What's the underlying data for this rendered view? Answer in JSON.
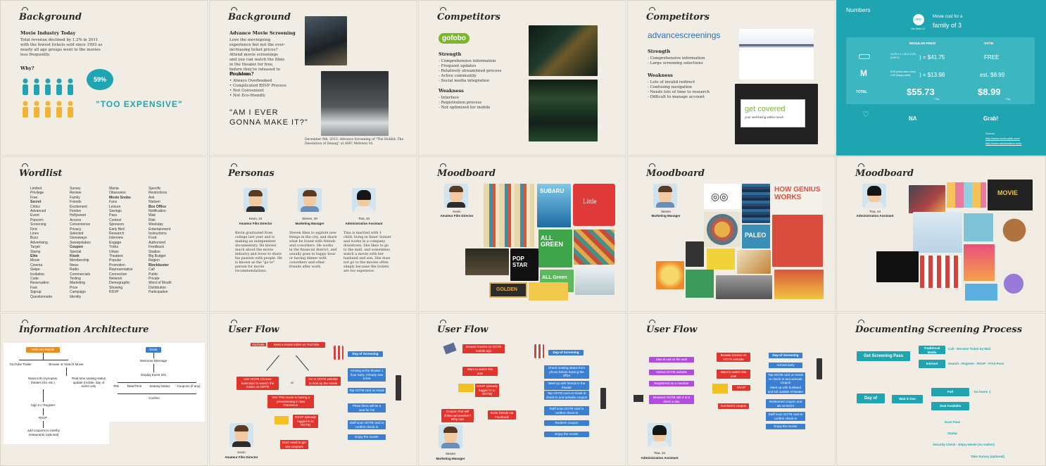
{
  "colors": {
    "paper": "#f1ede4",
    "teal": "#1fa5b1",
    "blue": "#3b7fd0",
    "orange": "#f08a1c",
    "red": "#e0342d",
    "yellow": "#f2c020",
    "green": "#1a6b52",
    "purple": "#b24ce0"
  },
  "slides": {
    "bg1": {
      "title": "Background",
      "heading": "Movie Industry Today",
      "body": "Total revenue declined by 1.2% in 2011 with the fewest tickets sold since 1993 as nearly all age groups went to the movies less frequently.",
      "why": "Why?",
      "percent": "59%",
      "quote": "\"TOO EXPENSIVE\""
    },
    "bg2": {
      "title": "Background",
      "heading": "Advance Movie Screening",
      "body": "Love the moviegoing experience but not the ever-increasing ticket prices? Attend movie screenings and you can watch the films in the theater for free, before they're released to the public.",
      "problem": "Problem?",
      "problems": [
        "• Always Overbooked",
        "• Complicated RSVP Process",
        "• Not Convenient",
        "• Not Eco-friendly"
      ],
      "quote1": "\"Am I ever",
      "quote2": "gonna make it?\"",
      "caption": "December 9th, 2013. Advance Screening of \"The Hobbit: The Desolation of Smaug\" at AMC Metreon 16."
    },
    "comp1": {
      "title": "Competitors",
      "logo": "gofobo",
      "strength": "Strength",
      "strengths": [
        "- Comprehensive information",
        "- Frequent updates",
        "- Relatively streamlined process",
        "- Active community",
        "- Social media integration"
      ],
      "weakness": "Weakness",
      "weaknesses": [
        "- Interface",
        "- Registration process",
        "- Not optimized for mobile"
      ]
    },
    "comp2": {
      "title": "Competitors",
      "logo": "advancescreenings",
      "strength": "Strength",
      "strengths": [
        "- Comprehensive information",
        "- Large screening selections"
      ],
      "weakness": "Weakness",
      "weaknesses": [
        "- Lots of invalid redirect",
        "- Confusing navigation",
        "- Needs lots of time to research",
        "- Difficult to manage account"
      ],
      "ad": "get covered",
      "ad_sub": "your well-being within reach"
    },
    "numbers": {
      "title": "Numbers",
      "amc": "amc",
      "amc_sub": "Van Ness 14",
      "cost_label": "Movie cost for a",
      "family": "family of 3",
      "col1": "REGULAR PRICE",
      "col2": "OOTB",
      "row1_calc": "14.25 X 2 = 28.5  13.25 (CHILD)",
      "row1_val": ") = $41.75",
      "row1_free": "FREE",
      "row2_calc": "8.99 (extra value meal)  4.99 (happy meal)",
      "row2_val": ") = $13.98",
      "row2_ootb": "est. $8.99",
      "total": "TOTAL",
      "total_val": "$55.73",
      "total_ootb": "$8.99",
      "tax": "+Tax",
      "na": "NA",
      "grab": "Grab!",
      "source": "Source:",
      "link1": "http://www.mcdonalds.com/",
      "link2": "http://www.amctheatres.com/"
    },
    "wordlist": {
      "title": "Wordlist",
      "cols": [
        [
          "Limited",
          "Privilege",
          "Free",
          "Secret",
          "Critics",
          "Advanced",
          "Event",
          "Popcorn",
          "Screening",
          "First",
          "Lines",
          "Buzz",
          "Advertising",
          "Target",
          "Stamp",
          "Elite",
          "Movie",
          "Cinema",
          "Swipe",
          "Invitation",
          "Code",
          "Reservation",
          "Fast",
          "Signup",
          "Questionnaire"
        ],
        [
          "Survey",
          "Review",
          "Family",
          "Friends",
          "Excitement",
          "Festive",
          "Hollywood",
          "Access",
          "Convenience",
          "Privacy",
          "Selected",
          "Giveaways",
          "Sweepstakes",
          "Coupon",
          "Special",
          "Kiosk",
          "Membership",
          "News",
          "Radio",
          "Commercials",
          "Texting",
          "Marketing",
          "Prize",
          "Campaign",
          "Identity"
        ],
        [
          "Mania",
          "Obsession",
          "Movie Snobs",
          "Fans",
          "Leisure",
          "Savings",
          "Pass",
          "Contest",
          "Sponsors",
          "Early Bird",
          "Research",
          "Interview",
          "Engage",
          "Tricks",
          "Urban",
          "Theaters",
          "Popular",
          "Promotion",
          "Representative",
          "Connection",
          "Network",
          "Demographic",
          "Showing",
          "RSVP"
        ],
        [
          "Specific",
          "Restrictions",
          "Ask",
          "Nielsen",
          "Box Office",
          "Notification",
          "Wait",
          "Risk",
          "Weekday",
          "Entertainment",
          "Instructions",
          "Food",
          "Authorized",
          "Feedback",
          "Studios",
          "Big Budget",
          "Region",
          "Blockbuster",
          "Call",
          "Public",
          "Private",
          "Word of Mouth",
          "Distribution",
          "Participation"
        ]
      ]
    },
    "personas": {
      "title": "Personas",
      "p1_name": "Kevin, 24",
      "p1_role": "Amateur Film Director",
      "p2_name": "Steven, 29",
      "p2_role": "Marketing Manager",
      "p3_name": "Tina, 34",
      "p3_role": "Administration Assistant",
      "p1_text": "Kevin graduated from college last year and is making an independent documentary. He knows much about the movie industry and loves to share his passion with people. He is known as the \"go to\" person for movie recommendations.",
      "p2_text": "Steven likes to explore new things in the city, and share what he found with friends and coworkers. He works in the financial district, and usually goes to happy hour or having dinner with coworkers and other friends after work.",
      "p3_text": "Tina is married with 1 child, living in Inner Sunset and works in a company downtown. She likes to go to the mall, and sometimes watch a movie with her husband and son. She does not go to the movies often simply because the tickets are too expensive."
    },
    "mood1": {
      "title": "Moodboard",
      "name": "Kevin",
      "role": "Amateur Film Director",
      "t1": "SUBARU",
      "t2": "Little",
      "t3": "ALL GREEN",
      "t4": "ALL Green",
      "t5": "POP STAR",
      "t6": "GOLDEN"
    },
    "mood2": {
      "title": "Moodboard",
      "name": "Steven",
      "role": "Marketing Manager",
      "t1": "HOW GENIUS WORKS",
      "t2": "PALEO"
    },
    "mood3": {
      "title": "Moodboard",
      "name": "Tina, 34",
      "role": "Administration Assistant",
      "t1": "MOVIE"
    },
    "ia": {
      "title": "Information Architecture",
      "web": "Web and Mobile",
      "kiosk": "Kiosk",
      "n1": "YouTube Trailer",
      "n2": "Browse or Search Movie",
      "n3": "Movie  Info (synopsis, theater info, etc.)",
      "n4": "Real-time seating status update (mobile, day of event only",
      "n5": "Sign In / Register",
      "n6": "RSVP",
      "n7": "add coupons to nearby restaurants (optional)",
      "k1": "Welcome Message",
      "k2": "Display Event Info",
      "k3": "Title",
      "k4": "Date/Time",
      "k5": "Seating Status",
      "k6": "Coupons (if any)",
      "k7": "Confirm"
    },
    "flow1": {
      "title": "User Flow",
      "top": "Sees a movie trailer on YouTube",
      "yt": "YouTube",
      "a": "Use OOTB Chrome extension to search the movie on OOTB",
      "or": "or",
      "b": "Go to OOTB website to look up the movie",
      "c": "Yes! This movie is having a prescreening in San Francisco!",
      "d": "RSVP (already logged in to OOTB)",
      "e": "Don't need to get any coupons",
      "day": "Day-of Screening",
      "d1": "Arriving at the theater 1 hour early. Already saw a line",
      "d2": "Tap OOTB card on Kiosk",
      "d3": "Phew there will be a seat for me",
      "d4": "Staff scan OOTB card to confirm check-in",
      "d5": "Enjoy the movie!",
      "name": "Kevin",
      "role": "Amateur Film Director"
    },
    "flow2": {
      "title": "User Flow",
      "top": "Browse movies on OOTB mobile app",
      "a": "Want to watch this one!",
      "b": "RSVP (already logged in to OOTB)",
      "c": "Coupon that will drinks w/coworker? Why not!",
      "d": "Invite friends via Facebook",
      "day": "Day-of Screening",
      "d1": "Check seating status from phone before leaving the office",
      "d2": "Meet up with friends in the theater",
      "d3": "Tap OOTB card on Kiosk to check-in and activate coupon",
      "d4": "Staff scan OOTB card to confirm check-in",
      "d5": "Redeem coupon",
      "d6": "Enjoy the movie!",
      "name": "Steven",
      "role": "Marketing Manager"
    },
    "flow3": {
      "title": "User Flow",
      "top": "Saw an ad on the web",
      "a": "Visited OOTB website",
      "b": "Registered as a member",
      "c": "Browsed OOTB site 4 to 5 times a day",
      "mid": "Browse movies on OOTB website",
      "m1": "Want to watch this one!",
      "m2": "RSVP",
      "m3": "Got McD's coupon",
      "day": "Day-of Screening",
      "d1": "Arrived early",
      "d2": "Tap OOTB card on Kiosk to check-in and activate coupon",
      "d3": "Meet up with husband and kid outside of theater",
      "d4": "Redeemed coupon and ate at McD's",
      "d5": "Staff scan OOTB card to confirm check-in",
      "d6": "Enjoy the movie!",
      "name": "Tina, 34",
      "role": "Administration Assistant"
    },
    "doc": {
      "title": "Documenting Screening Process",
      "get": "Get Screening Pass",
      "trad": "Traditional Media",
      "trad_t": "Call - Receive Ticket by Mail",
      "internet": "Internet",
      "internet_t": "Search - Register - RSVP - Print Pass",
      "dayof": "Day of",
      "wait": "Wait in line",
      "full": "Full",
      "full_t": "- Go home :(",
      "seat": "Seat Available",
      "scan": "Scan Pass",
      "stamp": "Stamp",
      "check": "Security Check  - Enjoy Movie (no trailer!)",
      "survey": "Take Survey (optional)"
    }
  }
}
